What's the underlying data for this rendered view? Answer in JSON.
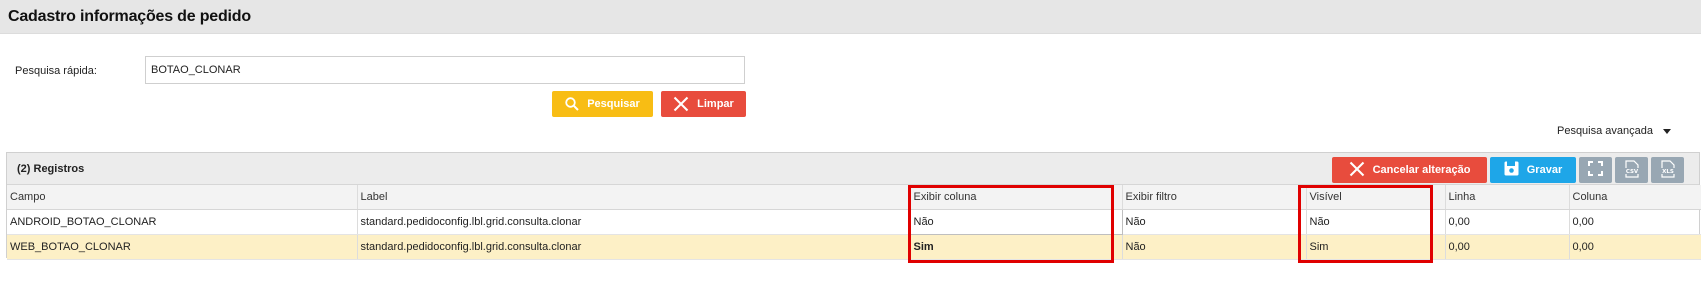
{
  "header": {
    "title": "Cadastro informações de pedido"
  },
  "quick_search": {
    "label": "Pesquisa rápida:",
    "value": "BOTAO_CLONAR",
    "search_label": "Pesquisar",
    "clear_label": "Limpar"
  },
  "advanced_search": {
    "label": "Pesquisa avançada"
  },
  "grid": {
    "records_label": "(2) Registros",
    "toolbar": {
      "cancel_label": "Cancelar alteração",
      "save_label": "Gravar",
      "csv_icon": "csv-icon",
      "xls_icon": "xls-icon",
      "fullscreen_icon": "fullscreen-icon"
    },
    "columns": [
      "Campo",
      "Label",
      "Exibir coluna",
      "Exibir filtro",
      "Visível",
      "Linha",
      "Coluna"
    ],
    "rows": [
      [
        "ANDROID_BOTAO_CLONAR",
        "standard.pedidoconfig.lbl.grid.consulta.clonar",
        "Não",
        "Não",
        "Não",
        "0,00",
        "0,00"
      ],
      [
        "WEB_BOTAO_CLONAR",
        "standard.pedidoconfig.lbl.grid.consulta.clonar",
        "Sim",
        "Não",
        "Sim",
        "0,00",
        "0,00"
      ]
    ]
  },
  "colors": {
    "search_button": "#f8bd14",
    "clear_button": "#e84c3d",
    "save_button": "#1ea6e8",
    "selected_row": "#fdf0c6",
    "highlight": "#e00000"
  }
}
